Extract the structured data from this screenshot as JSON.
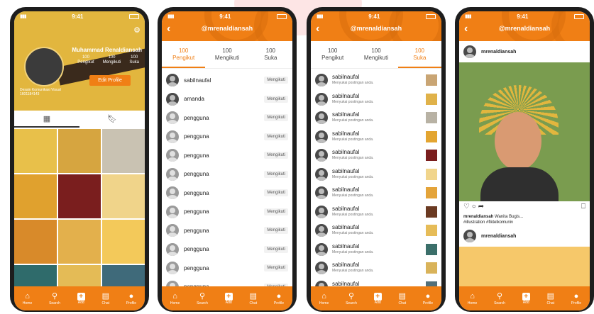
{
  "status": {
    "time": "9:41"
  },
  "profile": {
    "name": "Muhammad Renaldiansah",
    "stats": [
      {
        "value": "100",
        "label": "Pengikut"
      },
      {
        "value": "100",
        "label": "Mengikuti"
      },
      {
        "value": "100",
        "label": "Suka"
      }
    ],
    "edit_label": "Edit Profile",
    "bio_line1": "Desain Komunikasi Visual",
    "bio_line2": "1601184143"
  },
  "username": "@mrenaldiansah",
  "follow_tabs": [
    {
      "value": "100",
      "label": "Pengikut"
    },
    {
      "value": "100",
      "label": "Mengikuti"
    },
    {
      "value": "100",
      "label": "Suka"
    }
  ],
  "followers": [
    {
      "name": "sabilnaufal",
      "button": "Mengikuti"
    },
    {
      "name": "amanda",
      "button": "Mengikuti"
    },
    {
      "name": "pengguna",
      "button": "Mengikuti"
    },
    {
      "name": "pengguna",
      "button": "Mengikuti"
    },
    {
      "name": "pengguna",
      "button": "Mengikuti"
    },
    {
      "name": "pengguna",
      "button": "Mengikuti"
    },
    {
      "name": "pengguna",
      "button": "Mengikuti"
    },
    {
      "name": "pengguna",
      "button": "Mengikuti"
    },
    {
      "name": "pengguna",
      "button": "Mengikuti"
    },
    {
      "name": "pengguna",
      "button": "Mengikuti"
    },
    {
      "name": "pengguna",
      "button": "Mengikuti"
    },
    {
      "name": "pengguna",
      "button": "Mengikuti"
    }
  ],
  "likes": {
    "name": "sabilnaufal",
    "text": "Menyukai postingan anda."
  },
  "post": {
    "user": "mrenaldiansah",
    "caption_user": "mrenaldiansah",
    "caption_text": "Wanita Bugis...",
    "hashtags": "#illustration #fiktelkomuniv"
  },
  "nav": [
    {
      "label": "Home",
      "icon": "⌂"
    },
    {
      "label": "Search",
      "icon": "⚲"
    },
    {
      "label": "Add",
      "icon": "+"
    },
    {
      "label": "Chat",
      "icon": "▤"
    },
    {
      "label": "Profile",
      "icon": "●"
    }
  ],
  "colors": {
    "accent": "#f07f15"
  }
}
